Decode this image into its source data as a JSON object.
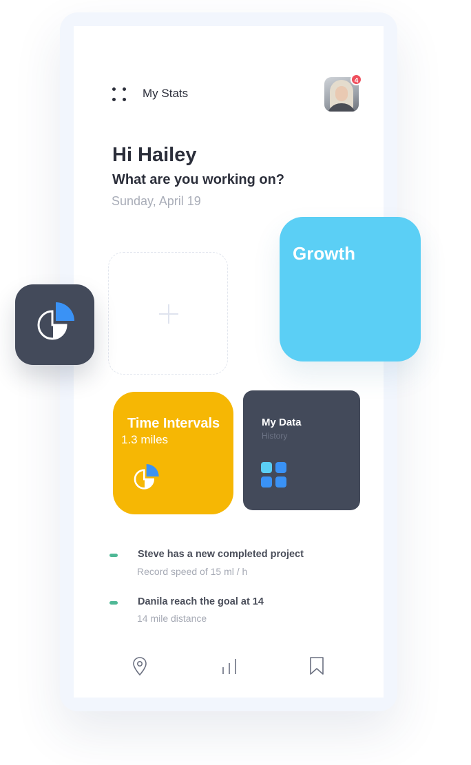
{
  "header": {
    "title": "My Stats",
    "notification_count": "4"
  },
  "hero": {
    "greeting": "Hi Hailey",
    "question": "What are you working on?",
    "date": "Sunday, April 19"
  },
  "cards": {
    "growth_label": "Growth",
    "time_intervals": {
      "title": "Time Intervals",
      "value": "1.3 miles"
    },
    "my_data": {
      "title": "My Data",
      "subtitle": "History"
    }
  },
  "feed": [
    {
      "title": "Steve has a new completed project",
      "detail": "Record speed of 15 ml / h"
    },
    {
      "title": "Danila reach the goal at 14",
      "detail": "14 mile distance"
    }
  ],
  "colors": {
    "growth": "#5bcff5",
    "time_intervals": "#f6b704",
    "dark_tile": "#434a5a",
    "accent_blue": "#3a92f5",
    "feed_dash": "#4fb896",
    "badge": "#ef4f5d"
  },
  "icons": {
    "menu": "menu-dots-icon",
    "chart": "pie-chart-icon",
    "grid": "grid-icon",
    "nav": [
      "location-pin-icon",
      "bar-chart-icon",
      "bookmark-icon"
    ]
  }
}
